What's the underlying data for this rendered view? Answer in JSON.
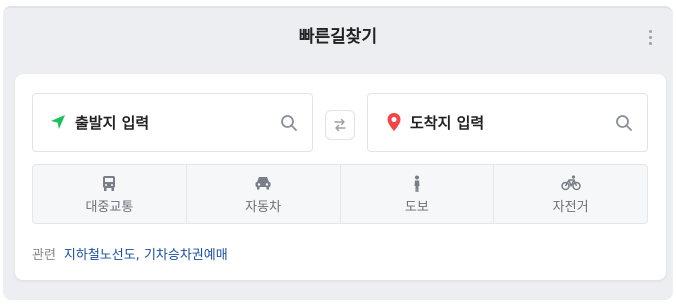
{
  "widget": {
    "title": "빠른길찾기",
    "origin_placeholder": "출발지 입력",
    "destination_placeholder": "도착지 입력",
    "modes": [
      "대중교통",
      "자동차",
      "도보",
      "자전거"
    ],
    "related_label": "관련",
    "related_link": "지하철노선도, 기차승차권예매"
  },
  "colors": {
    "origin_icon": "#19c15a",
    "destination_icon": "#f0484a",
    "link": "#1a4fa3"
  },
  "icons": [
    "navigation-arrow-icon",
    "map-pin-icon",
    "search-icon",
    "swap-icon",
    "bus-icon",
    "car-icon",
    "walk-icon",
    "bicycle-icon",
    "more-vertical-icon"
  ]
}
